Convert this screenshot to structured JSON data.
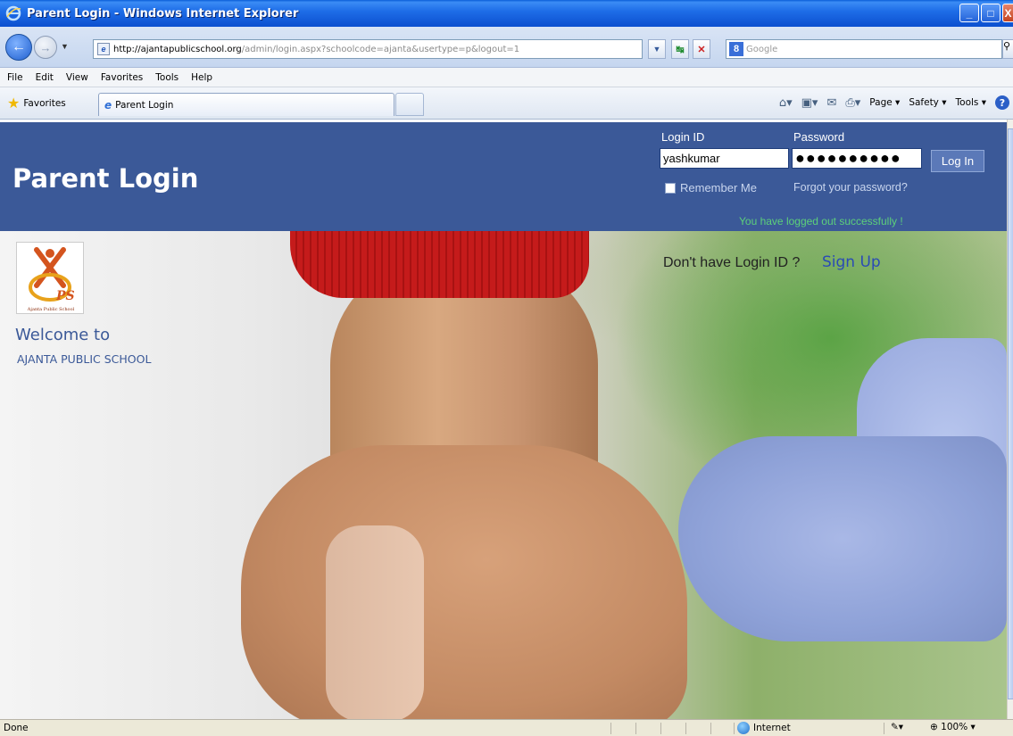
{
  "window": {
    "title": "Parent Login - Windows Internet Explorer",
    "controls": [
      "minimize",
      "maximize",
      "close"
    ]
  },
  "address": {
    "url_host": "http://ajantapublicschool.org",
    "url_path": "/admin/login.aspx?schoolcode=ajanta&usertype=p&logout=1",
    "search_placeholder": "Google"
  },
  "menu": [
    "File",
    "Edit",
    "View",
    "Favorites",
    "Tools",
    "Help"
  ],
  "tabbar": {
    "favorites_label": "Favorites",
    "tab_title": "Parent Login",
    "page_label": "Page",
    "safety_label": "Safety",
    "tools_label": "Tools"
  },
  "header": {
    "title": "Parent Login",
    "login_id_label": "Login ID",
    "login_id_value": "yashkumar",
    "password_label": "Password",
    "password_value": "●●●●●●●●●●",
    "login_button": "Log In",
    "remember_label": "Remember Me",
    "forgot_label": "Forgot your password?",
    "message": "You have logged out successfully !",
    "message_color": "#5cd07a",
    "brand_color": "#3b5998"
  },
  "content": {
    "logo_text": "PS",
    "logo_caption": "Ajanta Public School",
    "welcome": "Welcome to",
    "school_name": "AJANTA PUBLIC SCHOOL",
    "signup_question": "Don't have Login ID ?",
    "signup_link": "Sign Up"
  },
  "status": {
    "text": "Done",
    "zone": "Internet",
    "zoom": "100%"
  }
}
